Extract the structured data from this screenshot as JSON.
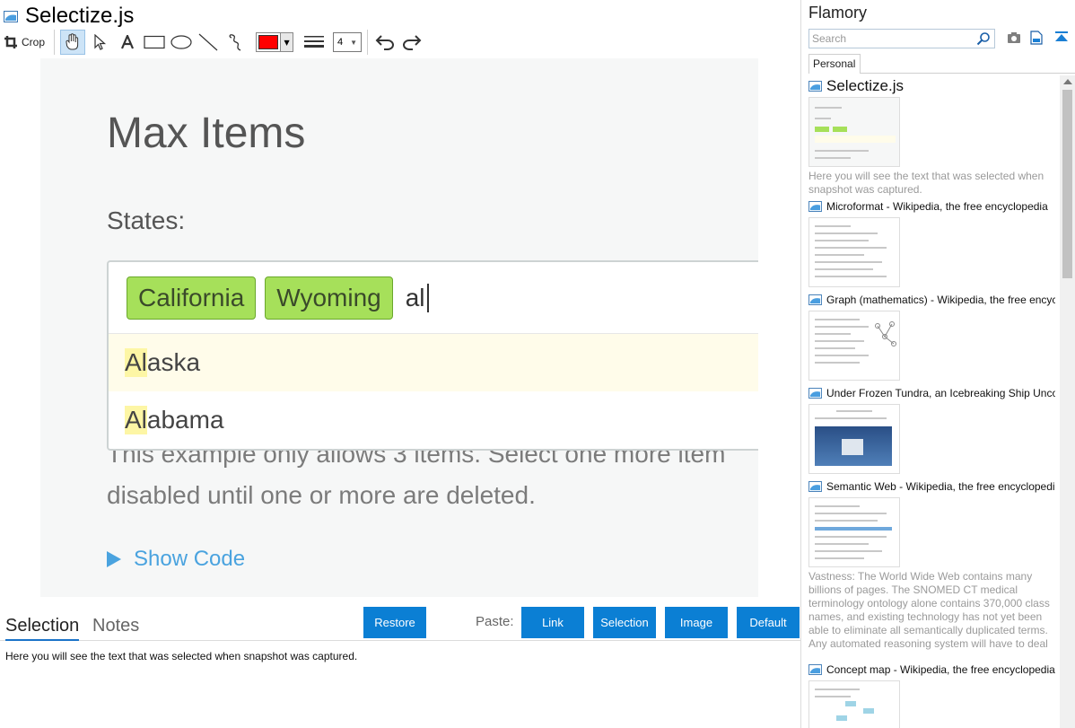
{
  "window": {
    "title": "Selectize.js"
  },
  "toolbar": {
    "crop_label": "Crop",
    "color": "#ff0000",
    "size_value": "4"
  },
  "snapshot": {
    "heading": "Max Items",
    "label": "States:",
    "chips": [
      "California",
      "Wyoming"
    ],
    "typed": "al",
    "options": [
      {
        "match": "Al",
        "rest": "aska"
      },
      {
        "match": "Al",
        "rest": "abama"
      }
    ],
    "paragraph_line1": "This example only allows 3 items. Select one more item",
    "paragraph_line2": "disabled until one or more are deleted.",
    "show_code": "Show Code"
  },
  "bottom": {
    "tabs": [
      "Selection",
      "Notes"
    ],
    "restore": "Restore",
    "paste_label": "Paste:",
    "paste_buttons": [
      "Link",
      "Selection",
      "Image",
      "Default"
    ],
    "selection_text": "Here you will see the text that was selected when snapshot was captured."
  },
  "sidebar": {
    "title": "Flamory",
    "search_placeholder": "Search",
    "tab": "Personal",
    "items": [
      {
        "title": "Selectize.js",
        "desc": "Here you will see the text that was selected when snapshot was captured."
      },
      {
        "title": "Microformat - Wikipedia, the free encyclopedia"
      },
      {
        "title": "Graph (mathematics) - Wikipedia, the free encyclopedia"
      },
      {
        "title": "Under Frozen Tundra, an Icebreaking Ship Uncovers"
      },
      {
        "title": "Semantic Web - Wikipedia, the free encyclopedia",
        "desc": "Vastness: The World Wide Web contains many billions of pages. The SNOMED CT medical terminology ontology alone contains 370,000 class names, and existing technology has not yet been able to eliminate all semantically duplicated terms. Any automated reasoning system will have to deal with truly huge inputs."
      },
      {
        "title": "Concept map - Wikipedia, the free encyclopedia"
      }
    ]
  }
}
